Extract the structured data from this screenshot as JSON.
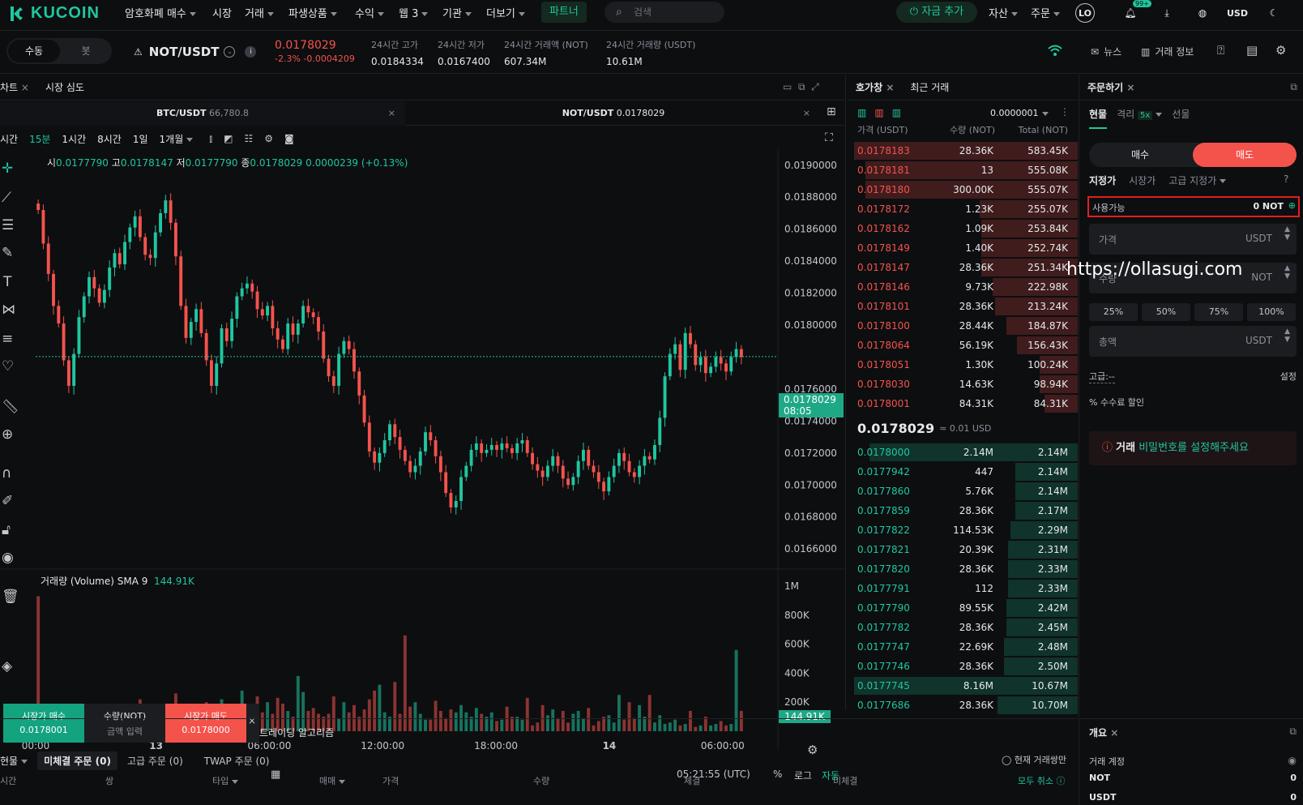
{
  "nav": {
    "logo": "KUCOIN",
    "items": [
      "암호화폐 매수",
      "시장",
      "거래",
      "파생상품",
      "수익",
      "웹 3",
      "기관",
      "더보기"
    ],
    "partner": "파트너",
    "search_placeholder": "검색",
    "deposit": "자금 추가",
    "assets": "자산",
    "orders": "주문",
    "avatar": "LO",
    "notif_badge": "99+",
    "currency": "USD"
  },
  "ticker": {
    "mode_manual": "수동",
    "mode_bot": "봇",
    "pair": "NOT/USDT",
    "price": "0.0178029",
    "change_pct": "-2.3%",
    "change_abs": "-0.0004209",
    "stats": [
      {
        "label": "24시간 고가",
        "value": "0.0184334"
      },
      {
        "label": "24시간 저가",
        "value": "0.0167400"
      },
      {
        "label": "24시간 거래액 (NOT)",
        "value": "607.34M"
      },
      {
        "label": "24시간 거래량 (USDT)",
        "value": "10.61M"
      }
    ],
    "news": "뉴스",
    "trade_info": "거래 정보"
  },
  "chart": {
    "tabs": [
      "차트",
      "시장 심도"
    ],
    "pair_tabs": [
      {
        "label": "BTC/USDT",
        "value": "66,780.8"
      },
      {
        "label": "NOT/USDT",
        "value": "0.0178029"
      }
    ],
    "intervals": [
      "시간",
      "15분",
      "1시간",
      "8시간",
      "1일",
      "1개월"
    ],
    "active_interval": "15분",
    "ohlc": {
      "o_label": "시",
      "o": "0.0177790",
      "h_label": "고",
      "h": "0.0178147",
      "l_label": "저",
      "l": "0.0177790",
      "c_label": "종",
      "c": "0.0178029",
      "change": "0.0000239 (+0.13%)"
    },
    "current_price": "0.0178029",
    "countdown": "08:05",
    "volume_label": "거래량 (Volume) SMA 9",
    "volume_value": "144.91K",
    "volume_tag": "144.91K",
    "time": "05:21:55 (UTC)",
    "pct": "%",
    "log": "로그",
    "auto": "자동"
  },
  "chart_data": {
    "type": "candlestick",
    "title": "",
    "price_ticks": [
      "0.0190000",
      "0.0188000",
      "0.0186000",
      "0.0184000",
      "0.0182000",
      "0.0180000",
      "0.0176000",
      "0.0174000",
      "0.0172000",
      "0.0170000",
      "0.0168000",
      "0.0166000"
    ],
    "price_ylim": [
      0.01654,
      0.01908
    ],
    "volume_ticks": [
      "1M",
      "800K",
      "600K",
      "400K",
      "200K"
    ],
    "x_ticks": [
      "00:00",
      "13",
      "06:00:00",
      "12:00:00",
      "18:00:00",
      "14",
      "06:00:00"
    ],
    "closes": [
      0.01872,
      0.01851,
      0.01832,
      0.01812,
      0.01801,
      0.01778,
      0.01762,
      0.01782,
      0.01805,
      0.01818,
      0.0183,
      0.01823,
      0.01814,
      0.01822,
      0.01836,
      0.01845,
      0.01838,
      0.01852,
      0.01861,
      0.01868,
      0.01855,
      0.01844,
      0.01842,
      0.01858,
      0.0187,
      0.01878,
      0.01864,
      0.01843,
      0.01812,
      0.01792,
      0.01802,
      0.0181,
      0.01795,
      0.01778,
      0.01762,
      0.01776,
      0.01798,
      0.0179,
      0.01804,
      0.01818,
      0.01823,
      0.01826,
      0.01821,
      0.0181,
      0.01806,
      0.01812,
      0.01798,
      0.01791,
      0.01785,
      0.01801,
      0.01794,
      0.01801,
      0.01812,
      0.01808,
      0.01805,
      0.01796,
      0.01779,
      0.01768,
      0.01762,
      0.01782,
      0.0179,
      0.01785,
      0.01771,
      0.01756,
      0.01739,
      0.01721,
      0.01714,
      0.0172,
      0.01728,
      0.01738,
      0.0173,
      0.01722,
      0.01715,
      0.01708,
      0.01712,
      0.01721,
      0.01733,
      0.01728,
      0.01718,
      0.01708,
      0.01695,
      0.01686,
      0.0169,
      0.01705,
      0.01712,
      0.01722,
      0.01726,
      0.0172,
      0.01722,
      0.01725,
      0.01722,
      0.01726,
      0.01723,
      0.0172,
      0.01726,
      0.01728,
      0.0172,
      0.01713,
      0.01709,
      0.01705,
      0.01712,
      0.01718,
      0.01712,
      0.01704,
      0.017,
      0.01705,
      0.01715,
      0.01722,
      0.01712,
      0.01708,
      0.01702,
      0.01696,
      0.01705,
      0.01712,
      0.0172,
      0.01715,
      0.01708,
      0.01705,
      0.01712,
      0.01718,
      0.01716,
      0.01725,
      0.01742,
      0.01768,
      0.01782,
      0.01788,
      0.01772,
      0.01795,
      0.01788,
      0.01775,
      0.0178,
      0.0177,
      0.01774,
      0.0178,
      0.01776,
      0.01771,
      0.0178,
      0.01785,
      0.0178
    ],
    "volumes": [
      0.93,
      0.15,
      0.12,
      0.1,
      0.14,
      0.09,
      0.12,
      0.16,
      0.1,
      0.11,
      0.12,
      0.18,
      0.09,
      0.16,
      0.14,
      0.12,
      0.19,
      0.08,
      0.14,
      0.1,
      0.22,
      0.13,
      0.08,
      0.12,
      0.06,
      0.09,
      0.16,
      0.26,
      0.11,
      0.13,
      0.17,
      0.07,
      0.1,
      0.2,
      0.14,
      0.05,
      0.22,
      0.12,
      0.11,
      0.17,
      0.28,
      0.15,
      0.09,
      0.24,
      0.13,
      0.2,
      0.12,
      0.23,
      0.19,
      0.14,
      0.1,
      0.38,
      0.27,
      0.14,
      0.16,
      0.12,
      0.1,
      0.12,
      0.24,
      0.09,
      0.2,
      0.13,
      0.18,
      0.1,
      0.15,
      0.22,
      0.28,
      0.32,
      0.13,
      0.1,
      0.34,
      0.12,
      0.66,
      0.17,
      0.2,
      0.12,
      0.08,
      0.08,
      0.21,
      0.14,
      0.09,
      0.15,
      0.13,
      0.18,
      0.13,
      0.1,
      0.16,
      0.12,
      0.1,
      0.13,
      0.07,
      0.08,
      0.17,
      0.1,
      0.1,
      0.08,
      0.23,
      0.04,
      0.06,
      0.18,
      0.11,
      0.15,
      0.09,
      0.14,
      0.06,
      0.12,
      0.14,
      0.09,
      0.16,
      0.04,
      0.07,
      0.1,
      0.11,
      0.06,
      0.25,
      0.08,
      0.2,
      0.09,
      0.18,
      0.1,
      0.25,
      0.06,
      0.11,
      0.05,
      0.06,
      0.08,
      0.04,
      0.05,
      0.14,
      0.03,
      0.04,
      0.1,
      0.04,
      0.05,
      0.07,
      0.04,
      0.05,
      0.56,
      0.14,
      0.0
    ]
  },
  "orderbook": {
    "tabs": [
      "호가창",
      "최근 거래"
    ],
    "precision": "0.0000001",
    "headers": [
      "가격 (USDT)",
      "수량 (NOT)",
      "Total (NOT)"
    ],
    "asks": [
      {
        "p": "0.0178183",
        "q": "28.36K",
        "t": "583.45K",
        "d": 1.0
      },
      {
        "p": "0.0178181",
        "q": "13",
        "t": "555.08K",
        "d": 0.95
      },
      {
        "p": "0.0178180",
        "q": "300.00K",
        "t": "555.07K",
        "d": 0.95
      },
      {
        "p": "0.0178172",
        "q": "1.23K",
        "t": "255.07K",
        "d": 0.44
      },
      {
        "p": "0.0178162",
        "q": "1.09K",
        "t": "253.84K",
        "d": 0.43
      },
      {
        "p": "0.0178149",
        "q": "1.40K",
        "t": "252.74K",
        "d": 0.43
      },
      {
        "p": "0.0178147",
        "q": "28.36K",
        "t": "251.34K",
        "d": 0.43
      },
      {
        "p": "0.0178146",
        "q": "9.73K",
        "t": "222.98K",
        "d": 0.38
      },
      {
        "p": "0.0178101",
        "q": "28.36K",
        "t": "213.24K",
        "d": 0.37
      },
      {
        "p": "0.0178100",
        "q": "28.44K",
        "t": "184.87K",
        "d": 0.32
      },
      {
        "p": "0.0178064",
        "q": "56.19K",
        "t": "156.43K",
        "d": 0.27
      },
      {
        "p": "0.0178051",
        "q": "1.30K",
        "t": "100.24K",
        "d": 0.17
      },
      {
        "p": "0.0178030",
        "q": "14.63K",
        "t": "98.94K",
        "d": 0.17
      },
      {
        "p": "0.0178001",
        "q": "84.31K",
        "t": "84.31K",
        "d": 0.15
      }
    ],
    "mid_price": "0.0178029",
    "mid_usd": "≈ 0.01 USD",
    "bids": [
      {
        "p": "0.0178000",
        "q": "2.14M",
        "t": "2.14M",
        "d": 0.93
      },
      {
        "p": "0.0177942",
        "q": "447",
        "t": "2.14M",
        "d": 0.28
      },
      {
        "p": "0.0177860",
        "q": "5.76K",
        "t": "2.14M",
        "d": 0.28
      },
      {
        "p": "0.0177859",
        "q": "28.36K",
        "t": "2.17M",
        "d": 0.28
      },
      {
        "p": "0.0177822",
        "q": "114.53K",
        "t": "2.29M",
        "d": 0.3
      },
      {
        "p": "0.0177821",
        "q": "20.39K",
        "t": "2.31M",
        "d": 0.31
      },
      {
        "p": "0.0177820",
        "q": "28.36K",
        "t": "2.33M",
        "d": 0.31
      },
      {
        "p": "0.0177791",
        "q": "112",
        "t": "2.33M",
        "d": 0.31
      },
      {
        "p": "0.0177790",
        "q": "89.55K",
        "t": "2.42M",
        "d": 0.32
      },
      {
        "p": "0.0177782",
        "q": "28.36K",
        "t": "2.45M",
        "d": 0.32
      },
      {
        "p": "0.0177747",
        "q": "22.69K",
        "t": "2.48M",
        "d": 0.33
      },
      {
        "p": "0.0177746",
        "q": "28.36K",
        "t": "2.50M",
        "d": 0.33
      },
      {
        "p": "0.0177745",
        "q": "8.16M",
        "t": "10.67M",
        "d": 1.0
      },
      {
        "p": "0.0177686",
        "q": "28.36K",
        "t": "10.70M",
        "d": 0.36
      }
    ]
  },
  "order": {
    "title": "주문하기",
    "types": [
      "현물",
      "격리",
      "5x",
      "선물"
    ],
    "buy": "매수",
    "sell": "매도",
    "modes": [
      "지정가",
      "시장가",
      "고급 지정가"
    ],
    "available_label": "사용가능",
    "available_value": "0 NOT",
    "price_ph": "가격",
    "price_unit": "USDT",
    "qty_ph": "수량",
    "qty_unit": "NOT",
    "pcts": [
      "25%",
      "50%",
      "75%",
      "100%"
    ],
    "total_ph": "총액",
    "total_unit": "USDT",
    "advanced": "고급:--",
    "settings": "설정",
    "fee": "수수료 할인",
    "warning_prefix": "거래",
    "warning_link": "비밀번호를 설정해주세요",
    "watermark": "https://ollasugi.com"
  },
  "quick": {
    "buy_label": "시장가 매수",
    "buy_price": "0.0178001",
    "qty_label": "수량(NOT)",
    "qty_ph": "금액 입력",
    "sell_label": "시장가 매도",
    "sell_price": "0.0178000",
    "algo": "트레이딩 알고리즘"
  },
  "bottom": {
    "market": "현물",
    "tabs": [
      "미체결 주문 (0)",
      "고급 주문 (0)",
      "TWAP 주문 (0)"
    ],
    "current_only": "현재 거래쌍만",
    "cols": [
      "시간",
      "쌍",
      "타입",
      "매매",
      "가격",
      "수량",
      "체결",
      "미체결"
    ],
    "cancel_all": "모두 취소"
  },
  "overview": {
    "title": "개요",
    "account": "거래 계정",
    "rows": [
      {
        "c": "NOT",
        "v": "0"
      },
      {
        "c": "USDT",
        "v": "0"
      }
    ]
  },
  "colors": {
    "up": "#1fc7a0",
    "down": "#f4534c",
    "bg": "#0d0e10"
  }
}
